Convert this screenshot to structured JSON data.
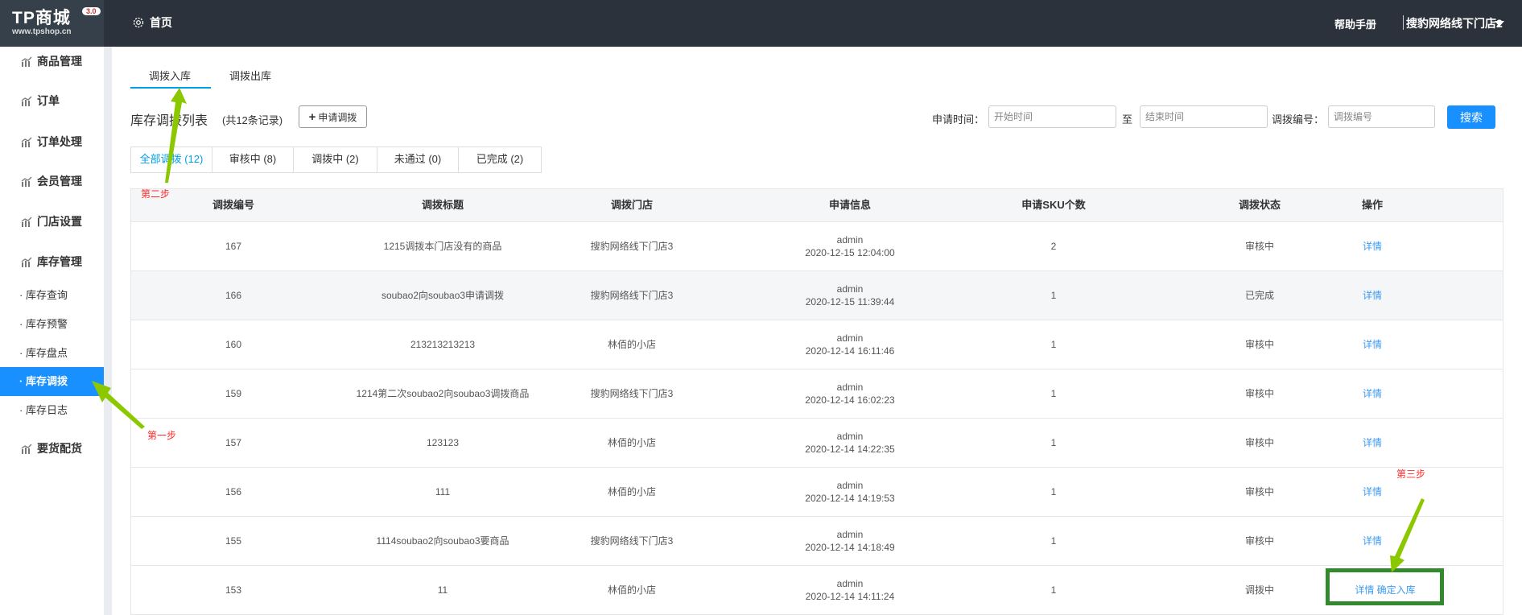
{
  "header": {
    "logo_text": "TP商城",
    "logo_version": "3.0",
    "logo_url": "www.tpshop.cn",
    "home": "首页",
    "help": "帮助手册",
    "store": "搜豹网络线下门店2"
  },
  "sidebar": {
    "items": [
      "商品管理",
      "订单",
      "订单处理",
      "会员管理",
      "门店设置",
      "库存管理"
    ],
    "sub_items": [
      "库存查询",
      "库存预警",
      "库存盘点",
      "库存调拨",
      "库存日志"
    ],
    "last_item": "要货配货",
    "active": "库存调拨"
  },
  "tabs": [
    "调拨入库",
    "调拨出库"
  ],
  "list": {
    "title": "库存调拨列表",
    "count": "(共12条记录)",
    "apply_button": "申请调拨"
  },
  "filters": {
    "time_label": "申请时间：",
    "start_placeholder": "开始时间",
    "to": "至",
    "end_placeholder": "结束时间",
    "no_label": "调拨编号：",
    "no_placeholder": "调拨编号",
    "search": "搜索"
  },
  "status_tabs": [
    "全部调拨 (12)",
    "审核中 (8)",
    "调拨中 (2)",
    "未通过 (0)",
    "已完成 (2)"
  ],
  "table": {
    "headers": [
      "调拨编号",
      "调拨标题",
      "调拨门店",
      "申请信息",
      "申请SKU个数",
      "调拨状态",
      "操作"
    ],
    "rows": [
      {
        "id": "167",
        "title": "1215调拨本门店没有的商品",
        "store": "搜豹网络线下门店3",
        "user": "admin",
        "time": "2020-12-15 12:04:00",
        "sku": "2",
        "status": "审核中",
        "actions": [
          "详情"
        ]
      },
      {
        "id": "166",
        "title": "soubao2向soubao3申请调拨",
        "store": "搜豹网络线下门店3",
        "user": "admin",
        "time": "2020-12-15 11:39:44",
        "sku": "1",
        "status": "已完成",
        "actions": [
          "详情"
        ]
      },
      {
        "id": "160",
        "title": "213213213213",
        "store": "林佰的小店",
        "user": "admin",
        "time": "2020-12-14 16:11:46",
        "sku": "1",
        "status": "审核中",
        "actions": [
          "详情"
        ]
      },
      {
        "id": "159",
        "title": "1214第二次soubao2向soubao3调拨商品",
        "store": "搜豹网络线下门店3",
        "user": "admin",
        "time": "2020-12-14 16:02:23",
        "sku": "1",
        "status": "审核中",
        "actions": [
          "详情"
        ]
      },
      {
        "id": "157",
        "title": "123123",
        "store": "林佰的小店",
        "user": "admin",
        "time": "2020-12-14 14:22:35",
        "sku": "1",
        "status": "审核中",
        "actions": [
          "详情"
        ]
      },
      {
        "id": "156",
        "title": "111",
        "store": "林佰的小店",
        "user": "admin",
        "time": "2020-12-14 14:19:53",
        "sku": "1",
        "status": "审核中",
        "actions": [
          "详情"
        ]
      },
      {
        "id": "155",
        "title": "1114soubao2向soubao3要商品",
        "store": "搜豹网络线下门店3",
        "user": "admin",
        "time": "2020-12-14 14:18:49",
        "sku": "1",
        "status": "审核中",
        "actions": [
          "详情"
        ]
      },
      {
        "id": "153",
        "title": "11",
        "store": "林佰的小店",
        "user": "admin",
        "time": "2020-12-14 14:11:24",
        "sku": "1",
        "status": "调拨中",
        "actions": [
          "详情",
          "确定入库"
        ]
      }
    ]
  },
  "annotations": {
    "step1": "第一步",
    "step2": "第二步",
    "step3": "第三步"
  },
  "colors": {
    "header": "#2b323b",
    "accent": "#1890ff",
    "link": "#3d9bf0",
    "annotation": "#ff2b2b",
    "arrow": "#8cc800",
    "highlight_box": "#338a2e"
  }
}
